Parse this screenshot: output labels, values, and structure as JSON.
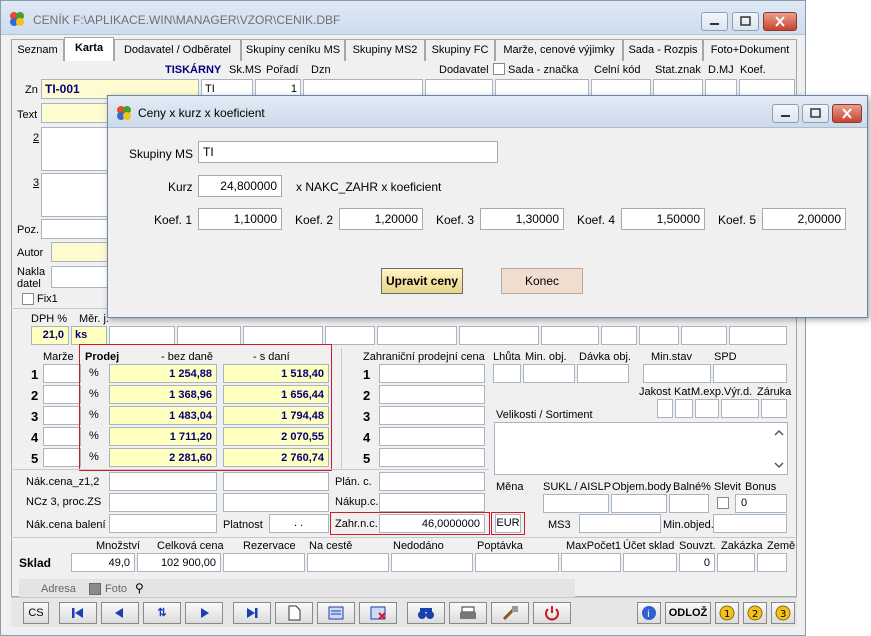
{
  "main_window": {
    "title": "CENÍK F:\\APLIKACE.WIN\\MANAGER\\VZOR\\CENIK.DBF",
    "tabs": [
      "Seznam",
      "Karta",
      "Dodavatel / Odběratel",
      "Skupiny ceníku MS",
      "Skupiny MS2",
      "Skupiny FC",
      "Marže, cenové výjimky",
      "Sada - Rozpis",
      "Foto+Dokument"
    ],
    "header_labels": {
      "tiskarny": "TISKÁRNY",
      "skms": "Sk.MS",
      "poradi": "Pořadí",
      "dzn": "Dzn",
      "dodavatel": "Dodavatel",
      "sada_znacka": "Sada - značka",
      "celni_kod": "Celní kód",
      "stat_znak": "Stat.znak",
      "dmj": "D.MJ",
      "koef": "Koef."
    },
    "header_values": {
      "skms": "TI",
      "poradi": "1"
    },
    "zn_label": "Zn",
    "zn_value": "TI-001",
    "text_label": "Text",
    "line2": "2",
    "line3": "3",
    "poz_label": "Poz.",
    "autor_label": "Autor",
    "nakla_label": "Nakla",
    "datel_label": "datel",
    "fix_label": "Fix1",
    "dph_label": "DPH %",
    "mer_label": "Měr. j.",
    "dph_value": "21,0",
    "mer_value": "ks",
    "prices": {
      "marze_label": "Marže",
      "prodej_label": "Prodej",
      "bez_dane_label": "- bez daně",
      "s_dani_label": "- s daní",
      "rows": [
        {
          "n": "1",
          "unit": "%",
          "bez": "1 254,88",
          "s": "1 518,40"
        },
        {
          "n": "2",
          "unit": "%",
          "bez": "1 368,96",
          "s": "1 656,44"
        },
        {
          "n": "3",
          "unit": "%",
          "bez": "1 483,04",
          "s": "1 794,48"
        },
        {
          "n": "4",
          "unit": "%",
          "bez": "1 711,20",
          "s": "2 070,55"
        },
        {
          "n": "5",
          "unit": "%",
          "bez": "2 281,60",
          "s": "2 760,74"
        }
      ]
    },
    "zahranicni_label": "Zahraniční prodejní cena",
    "zahr_rows": [
      "1",
      "2",
      "3",
      "4",
      "5"
    ],
    "right_labels": {
      "lhuta": "Lhůta",
      "min_obj": "Min. obj.",
      "davka": "Dávka obj.",
      "min_stav": "Min.stav",
      "spd": "SPD",
      "jakost": "Jakost",
      "kat": "Kat.",
      "m_exp": "M.exp.",
      "vyr_d": "Výr.d.",
      "zaruka": "Záruka",
      "velikosti": "Velikosti / Sortiment",
      "mena": "Měna",
      "sukl": "SUKL / AISLP",
      "objem": "Objem.body",
      "balne": "Balné%",
      "slevit": "Slevit",
      "bonus": "Bonus",
      "ms3": "MS3",
      "min_objed": "Min.objed."
    },
    "bonus_value": "0",
    "lower": {
      "nak_cena": "Nák.cena_z1,2",
      "ncz3": "NCz 3, proc.ZS",
      "nak_baleni": "Nák.cena balení",
      "platnost": "Platnost",
      "platnost_value": ". .",
      "plan_c": "Plán. c.",
      "nakup_c": "Nákup.c.",
      "zahr_nc": "Zahr.n.c.",
      "zahr_nc_value": "46,0000000",
      "currency": "EUR"
    },
    "sklad": {
      "label": "Sklad",
      "mnozstvi_label": "Množství",
      "celkova_label": "Celková cena",
      "rezervace": "Rezervace",
      "na_ceste": "Na cestě",
      "nedodano": "Nedodáno",
      "poptavka": "Poptávka",
      "max_pocet": "MaxPočet1",
      "ucet_sklad": "Účet sklad",
      "souvzt": "Souvzt.",
      "zakazka": "Zakázka",
      "zeme": "Země",
      "mnozstvi": "49,0",
      "celkova": "102 900,00",
      "souvzt_value": "0"
    },
    "footer_tabs": {
      "adresa": "Adresa",
      "foto": "Foto"
    },
    "buttons": {
      "cs": "CS",
      "odloz": "ODLOŽ"
    }
  },
  "dialog": {
    "title": "Ceny x kurz x koeficient",
    "skupiny_label": "Skupiny MS",
    "skupiny_value": "TI",
    "kurz_label": "Kurz",
    "kurz_value": "24,800000",
    "formula": "x NAKC_ZAHR  x  koeficient",
    "koefs": [
      {
        "label": "Koef. 1",
        "value": "1,10000"
      },
      {
        "label": "Koef. 2",
        "value": "1,20000"
      },
      {
        "label": "Koef. 3",
        "value": "1,30000"
      },
      {
        "label": "Koef. 4",
        "value": "1,50000"
      },
      {
        "label": "Koef. 5",
        "value": "2,00000"
      }
    ],
    "upravit_label": "Upravit ceny",
    "konec_label": "Konec"
  },
  "colors": {
    "accent_red": "#d01a2a",
    "field_yellow": "#ffffc0",
    "title_blue": "#00007a"
  }
}
